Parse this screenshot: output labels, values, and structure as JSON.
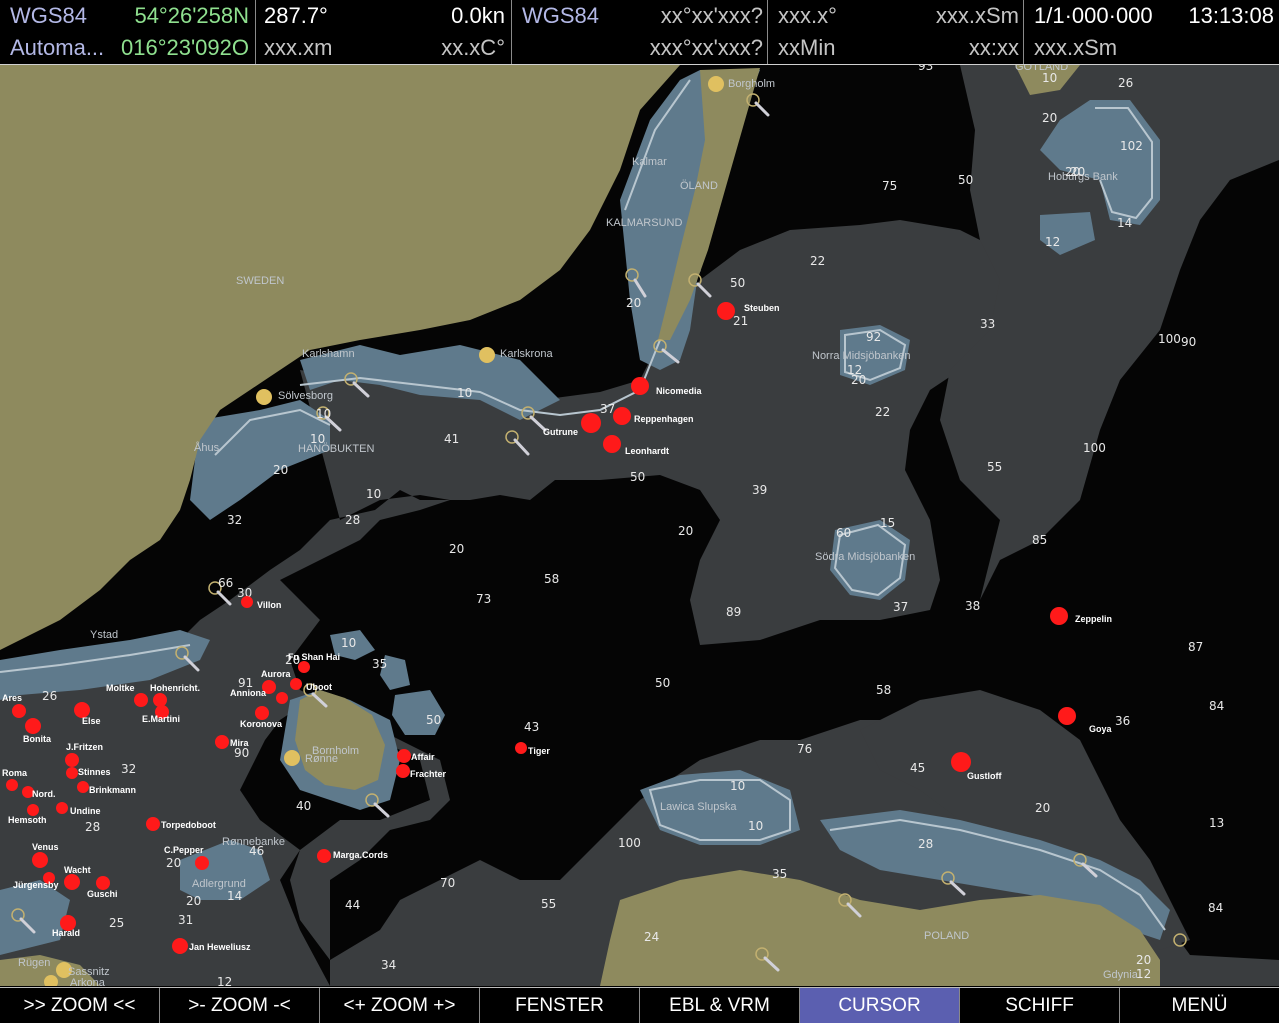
{
  "status": {
    "datum1": "WGS84",
    "lat": "54°26'258N",
    "source": "Automa...",
    "lon": "016°23'092O",
    "heading": "287.7°",
    "speed": "0.0kn",
    "dist1": "xxx.xm",
    "temp": "xx.xC°",
    "datum2": "WGS84",
    "cur_lat": "xx°xx'xxx?",
    "cur_lon": "xxx°xx'xxx?",
    "bearing": "xxx.x°",
    "range": "xxx.xSm",
    "time_min": "xxMin",
    "time_hm": "xx:xx",
    "scale": "1/1·000·000",
    "clock": "13:13:08",
    "dist2": "xxx.xSm"
  },
  "menu": [
    {
      "label": ">> ZOOM <<"
    },
    {
      "label": ">- ZOOM -<"
    },
    {
      "label": "<+ ZOOM +>"
    },
    {
      "label": "FENSTER"
    },
    {
      "label": "EBL & VRM"
    },
    {
      "label": "CURSOR"
    },
    {
      "label": "SCHIFF"
    },
    {
      "label": "MENÜ"
    }
  ],
  "places": [
    "SWEDEN",
    "ÖLAND",
    "KALMARSUND",
    "Kalmar",
    "Borgholm",
    "Karlshamn",
    "Karlskrona",
    "Sölvesborg",
    "Åhus",
    "HANÖBUKTEN",
    "Ystad",
    "Norra Midsjöbanken",
    "Södra Midsjöbanken",
    "Hoburgs Bank",
    "GOTLAND",
    "Bornholm",
    "Rønne",
    "Rønnebanke",
    "Adlergrund",
    "Lawica Slupska",
    "POLAND",
    "Rügen",
    "Sassnitz",
    "Arkona",
    "Gdynia"
  ],
  "wrecks": [
    "Steuben",
    "Nicomedia",
    "Reppenhagen",
    "Gutrune",
    "Leonhardt",
    "Villon",
    "Fu Shan Hai",
    "Aurora",
    "Anniona",
    "Koronova",
    "Uboot",
    "Moltke",
    "Hohenricht.",
    "E.Martini",
    "Ares",
    "Else",
    "Bonita",
    "J.Fritzen",
    "Mira",
    "Stinnes",
    "Roma",
    "Brinkmann",
    "Nord.",
    "Undine",
    "Hemsoth",
    "Torpedoboot",
    "Affair",
    "Frachter",
    "Tiger",
    "C.Pepper",
    "Venus",
    "Marga.Cords",
    "Wacht",
    "Jürgensby",
    "Guschi",
    "Harald",
    "Jan Heweliusz",
    "Zeppelin",
    "Goya",
    "Gustloff"
  ],
  "depths": [
    "93",
    "26",
    "10",
    "20",
    "75",
    "50",
    "20",
    "102",
    "20",
    "14",
    "12",
    "22",
    "50",
    "21",
    "33",
    "100",
    "90",
    "20",
    "92",
    "12",
    "20",
    "10",
    "37",
    "41",
    "10",
    "10",
    "10",
    "20",
    "50",
    "39",
    "22",
    "55",
    "100",
    "32",
    "28",
    "20",
    "60",
    "15",
    "20",
    "58",
    "85",
    "73",
    "89",
    "37",
    "38",
    "66",
    "30",
    "10",
    "35",
    "50",
    "20",
    "58",
    "87",
    "91",
    "26",
    "50",
    "43",
    "90",
    "36",
    "84",
    "76",
    "32",
    "45",
    "40",
    "10",
    "20",
    "28",
    "46",
    "14",
    "10",
    "13",
    "100",
    "35",
    "20",
    "28",
    "20",
    "70",
    "55",
    "44",
    "24",
    "84",
    "34",
    "25",
    "31",
    "12",
    "20",
    "12"
  ]
}
